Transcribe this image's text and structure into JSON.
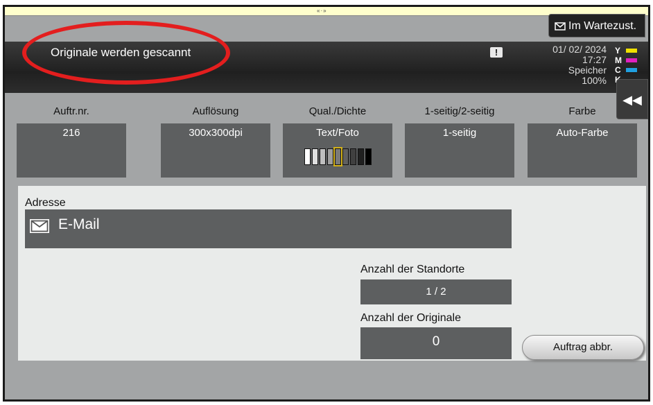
{
  "status": {
    "message": "Originale werden gescannt",
    "date": "01/ 02/ 2024",
    "time": "17:27",
    "memory_label": "Speicher",
    "memory_value": "100%",
    "alert_glyph": "!"
  },
  "toner": [
    {
      "label": "Y",
      "color": "#f0e000"
    },
    {
      "label": "M",
      "color": "#e020c0"
    },
    {
      "label": "C",
      "color": "#20a0e0"
    },
    {
      "label": "K",
      "color": "#222222"
    }
  ],
  "wait_tab": {
    "label": "Im Wartezust.",
    "icon": "envelope-icon"
  },
  "collapse": {
    "glyph": "◀◀",
    "icon": "double-chevron-left-icon"
  },
  "grip": "«·»",
  "settings": {
    "job_no": {
      "label": "Auftr.nr.",
      "value": "216"
    },
    "resolution": {
      "label": "Auflösung",
      "value": "300x300dpi"
    },
    "quality": {
      "label": "Qual./Dichte",
      "value": "Text/Foto",
      "density_level": 5,
      "density_steps": 9
    },
    "duplex": {
      "label": "1-seitig/2-seitig",
      "value": "1-seitig"
    },
    "color": {
      "label": "Farbe",
      "value": "Auto-Farbe"
    }
  },
  "address": {
    "label": "Adresse",
    "value": "E-Mail",
    "icon": "envelope-icon"
  },
  "locations": {
    "label": "Anzahl der Standorte",
    "value": "1  /  2"
  },
  "originals": {
    "label": "Anzahl der Originale",
    "value": "0"
  },
  "abort_button": {
    "label": "Auftrag abbr."
  },
  "annotation_color": "#e31e1e"
}
